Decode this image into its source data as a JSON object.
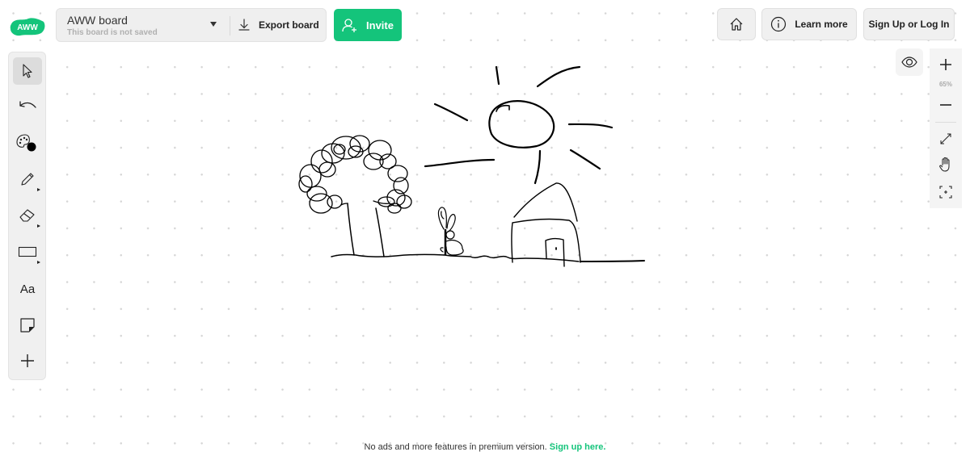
{
  "app": {
    "logo_text": "AWW",
    "brand_color": "#14c47b"
  },
  "board": {
    "name": "AWW board",
    "status": "This board is not saved",
    "export_label": "Export board"
  },
  "header": {
    "invite_label": "Invite",
    "learn_more_label": "Learn more",
    "signup_label": "Sign Up or Log In"
  },
  "toolbar": {
    "tools": [
      {
        "name": "select",
        "icon": "cursor-icon",
        "active": true
      },
      {
        "name": "undo",
        "icon": "undo-icon"
      },
      {
        "name": "color",
        "icon": "palette-icon",
        "current_color": "#000000"
      },
      {
        "name": "pen",
        "icon": "pencil-icon",
        "has_submenu": true
      },
      {
        "name": "eraser",
        "icon": "eraser-icon",
        "has_submenu": true
      },
      {
        "name": "shape",
        "icon": "rectangle-icon",
        "has_submenu": true
      },
      {
        "name": "text",
        "icon": "text-icon",
        "label": "Aa"
      },
      {
        "name": "sticky-note",
        "icon": "sticky-note-icon"
      },
      {
        "name": "add",
        "icon": "plus-icon"
      }
    ]
  },
  "zoom": {
    "level": "65%"
  },
  "footer": {
    "text": "No ads and more features in premium version. ",
    "link_label": "Sign up here."
  }
}
